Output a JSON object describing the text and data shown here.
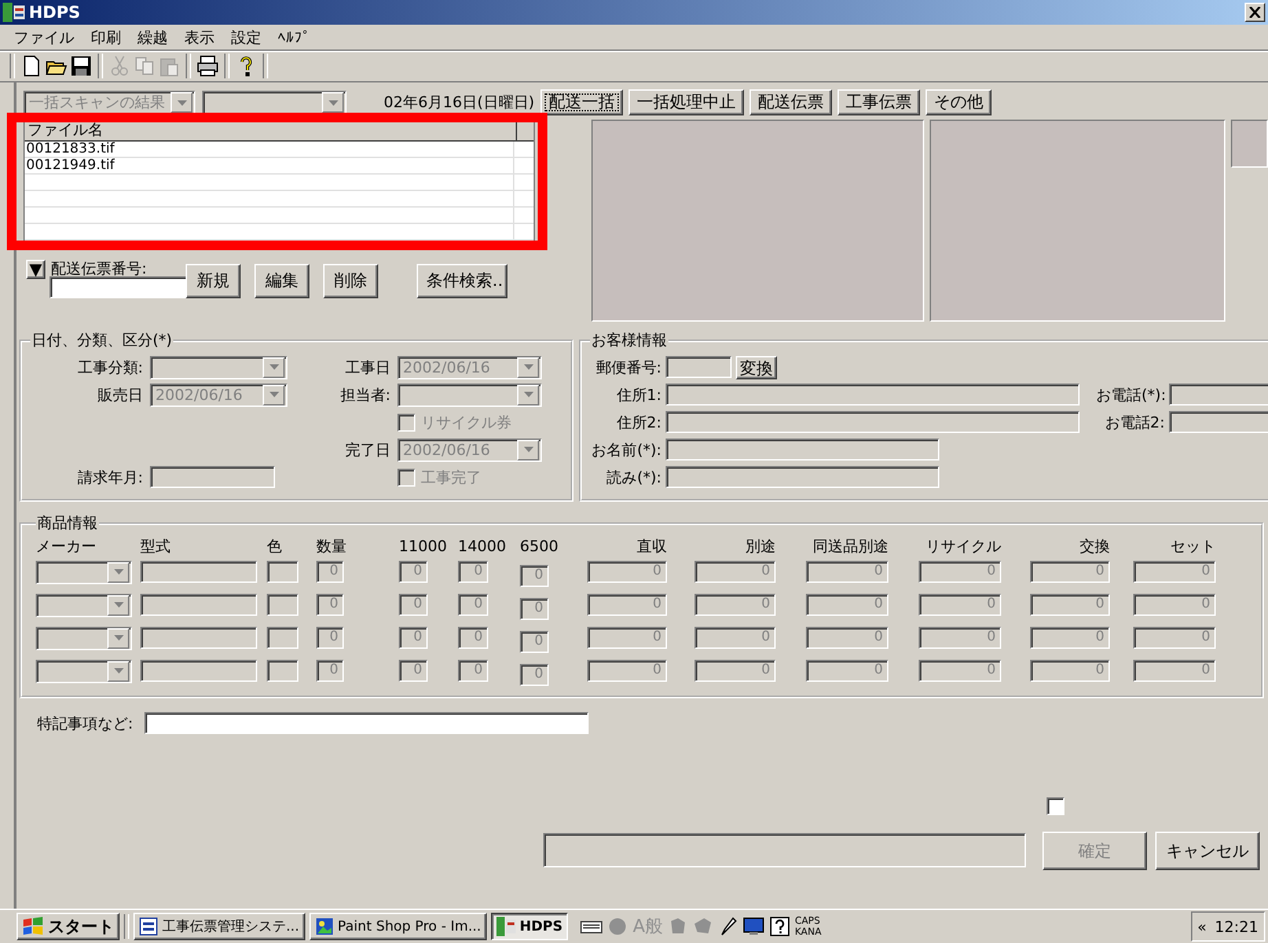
{
  "window": {
    "title": "HDPS"
  },
  "menu": [
    "ファイル",
    "印刷",
    "繰越",
    "表示",
    "設定",
    "ﾍﾙﾌﾟ"
  ],
  "toolbar_groups": [
    [
      {
        "kind": "new",
        "disabled": false
      },
      {
        "kind": "open",
        "disabled": false
      },
      {
        "kind": "save",
        "disabled": false
      }
    ],
    [
      {
        "kind": "cut",
        "disabled": true
      },
      {
        "kind": "copy",
        "disabled": true
      },
      {
        "kind": "paste",
        "disabled": true
      }
    ],
    [
      {
        "kind": "print",
        "disabled": false
      }
    ],
    [
      {
        "kind": "help",
        "disabled": false
      }
    ]
  ],
  "scan": {
    "result_combo": "一括スキャンの結果",
    "date": "02年6月16日(日曜日)"
  },
  "file_list": {
    "columns": [
      "ファイル名"
    ],
    "rows": [
      "00121833.tif",
      "00121949.tif"
    ]
  },
  "slip": {
    "toggle": "▼",
    "label": "配送伝票番号:",
    "buttons": [
      "新規",
      "編集",
      "削除",
      "条件検索.."
    ]
  },
  "actions": [
    {
      "label": "配送一括",
      "focused": true
    },
    {
      "label": "一括処理中止",
      "focused": false
    },
    {
      "label": "配送伝票",
      "focused": false
    },
    {
      "label": "工事伝票",
      "focused": false
    },
    {
      "label": "その他",
      "focused": false
    }
  ],
  "date_group": {
    "title": "日付、分類、区分(*)",
    "left": [
      {
        "kind": "combo",
        "label": "工事分類:",
        "disabled": true
      },
      {
        "kind": "combo",
        "label": "販売日",
        "value": "2002/06/16",
        "disabled": true
      },
      {
        "kind": "field",
        "label": "請求年月:",
        "disabled": true
      }
    ],
    "right": [
      {
        "kind": "combo",
        "label": "工事日",
        "value": "2002/06/16",
        "disabled": true
      },
      {
        "kind": "combo",
        "label": "担当者:",
        "disabled": true
      },
      {
        "kind": "checkbox",
        "label": "リサイクル券",
        "checked": false,
        "disabled": true
      },
      {
        "kind": "combo",
        "label": "完了日",
        "value": "2002/06/16",
        "disabled": true
      },
      {
        "kind": "checkbox",
        "label": "工事完了",
        "checked": false,
        "disabled": true
      }
    ]
  },
  "customer": {
    "title": "お客様情報",
    "rows": [
      {
        "kind": "postal",
        "label": "郵便番号:",
        "button": "変換"
      },
      {
        "kind": "long",
        "label": "住所1:",
        "phone": "お電話(*):"
      },
      {
        "kind": "long",
        "label": "住所2:",
        "phone": "お電話2:"
      },
      {
        "kind": "short",
        "label": "お名前(*):"
      },
      {
        "kind": "short",
        "label": "読み(*):"
      }
    ]
  },
  "products": {
    "title": "商品情報",
    "columns": [
      "メーカー",
      "型式",
      "色",
      "数量",
      "11000",
      "14000",
      "6500",
      "直収",
      "別途",
      "同送品別途",
      "リサイクル",
      "交換",
      "セット"
    ],
    "rows": [
      {
        "values": [
          "0",
          "0",
          "0",
          "0",
          "0",
          "0",
          "0",
          "0",
          "0",
          "0"
        ]
      },
      {
        "values": [
          "0",
          "0",
          "0",
          "0",
          "0",
          "0",
          "0",
          "0",
          "0",
          "0"
        ]
      },
      {
        "values": [
          "0",
          "0",
          "0",
          "0",
          "0",
          "0",
          "0",
          "0",
          "0",
          "0"
        ]
      },
      {
        "values": [
          "0",
          "0",
          "0",
          "0",
          "0",
          "0",
          "0",
          "0",
          "0",
          "0"
        ]
      }
    ]
  },
  "remarks": {
    "label": "特記事項など:"
  },
  "footer": {
    "checkbox": {
      "checked": false
    },
    "buttons": [
      {
        "label": "確定",
        "disabled": true
      },
      {
        "label": "キャンセル",
        "disabled": false
      }
    ]
  },
  "taskbar": {
    "start": "スタート",
    "tasks": [
      {
        "label": "工事伝票管理システ...",
        "selected": false
      },
      {
        "label": "Paint Shop Pro - Im...",
        "selected": false
      },
      {
        "label": "HDPS",
        "selected": true
      }
    ],
    "ime": "A般",
    "caps": "CAPS",
    "kana": "KANA",
    "chevron": "«",
    "clock": "12:21"
  }
}
